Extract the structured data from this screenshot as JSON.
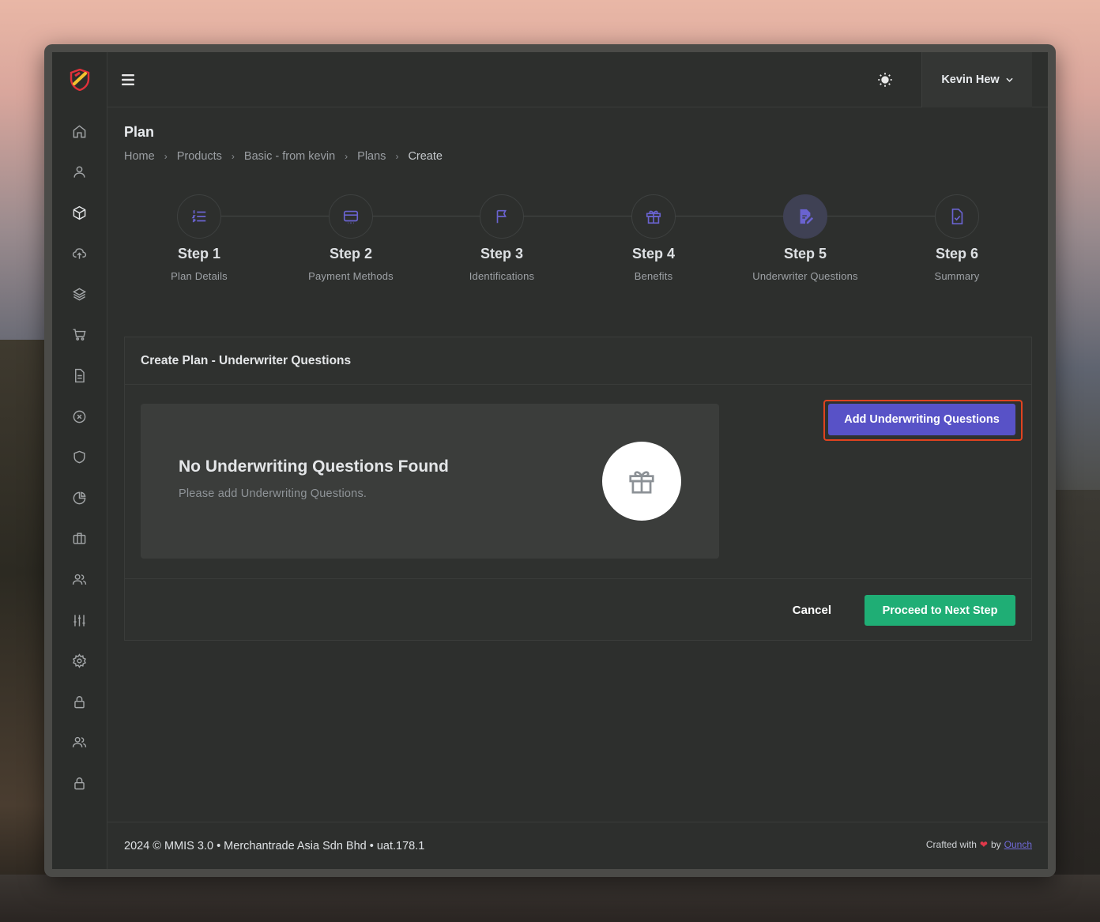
{
  "user": {
    "name": "Kevin Hew"
  },
  "page": {
    "title": "Plan"
  },
  "breadcrumb": [
    "Home",
    "Products",
    "Basic - from kevin",
    "Plans",
    "Create"
  ],
  "steps": [
    {
      "title": "Step 1",
      "label": "Plan Details",
      "icon": "list-icon"
    },
    {
      "title": "Step 2",
      "label": "Payment Methods",
      "icon": "credit-card-icon"
    },
    {
      "title": "Step 3",
      "label": "Identifications",
      "icon": "flag-icon"
    },
    {
      "title": "Step 4",
      "label": "Benefits",
      "icon": "gift-icon"
    },
    {
      "title": "Step 5",
      "label": "Underwriter Questions",
      "icon": "document-edit-icon",
      "active": true
    },
    {
      "title": "Step 6",
      "label": "Summary",
      "icon": "document-check-icon"
    }
  ],
  "card": {
    "title": "Create Plan - Underwriter Questions",
    "add_button": "Add Underwriting Questions",
    "empty_title": "No Underwriting Questions Found",
    "empty_subtitle": "Please add Underwriting Questions.",
    "cancel_button": "Cancel",
    "next_button": "Proceed to Next Step"
  },
  "footer": {
    "left": "2024 © MMIS 3.0 • Merchantrade Asia Sdn Bhd • uat.178.1",
    "crafted": "Crafted with",
    "by": "by",
    "link": "Ounch"
  },
  "colors": {
    "accent": "#5852c7",
    "success": "#1fae75",
    "highlight": "#e0431f"
  }
}
